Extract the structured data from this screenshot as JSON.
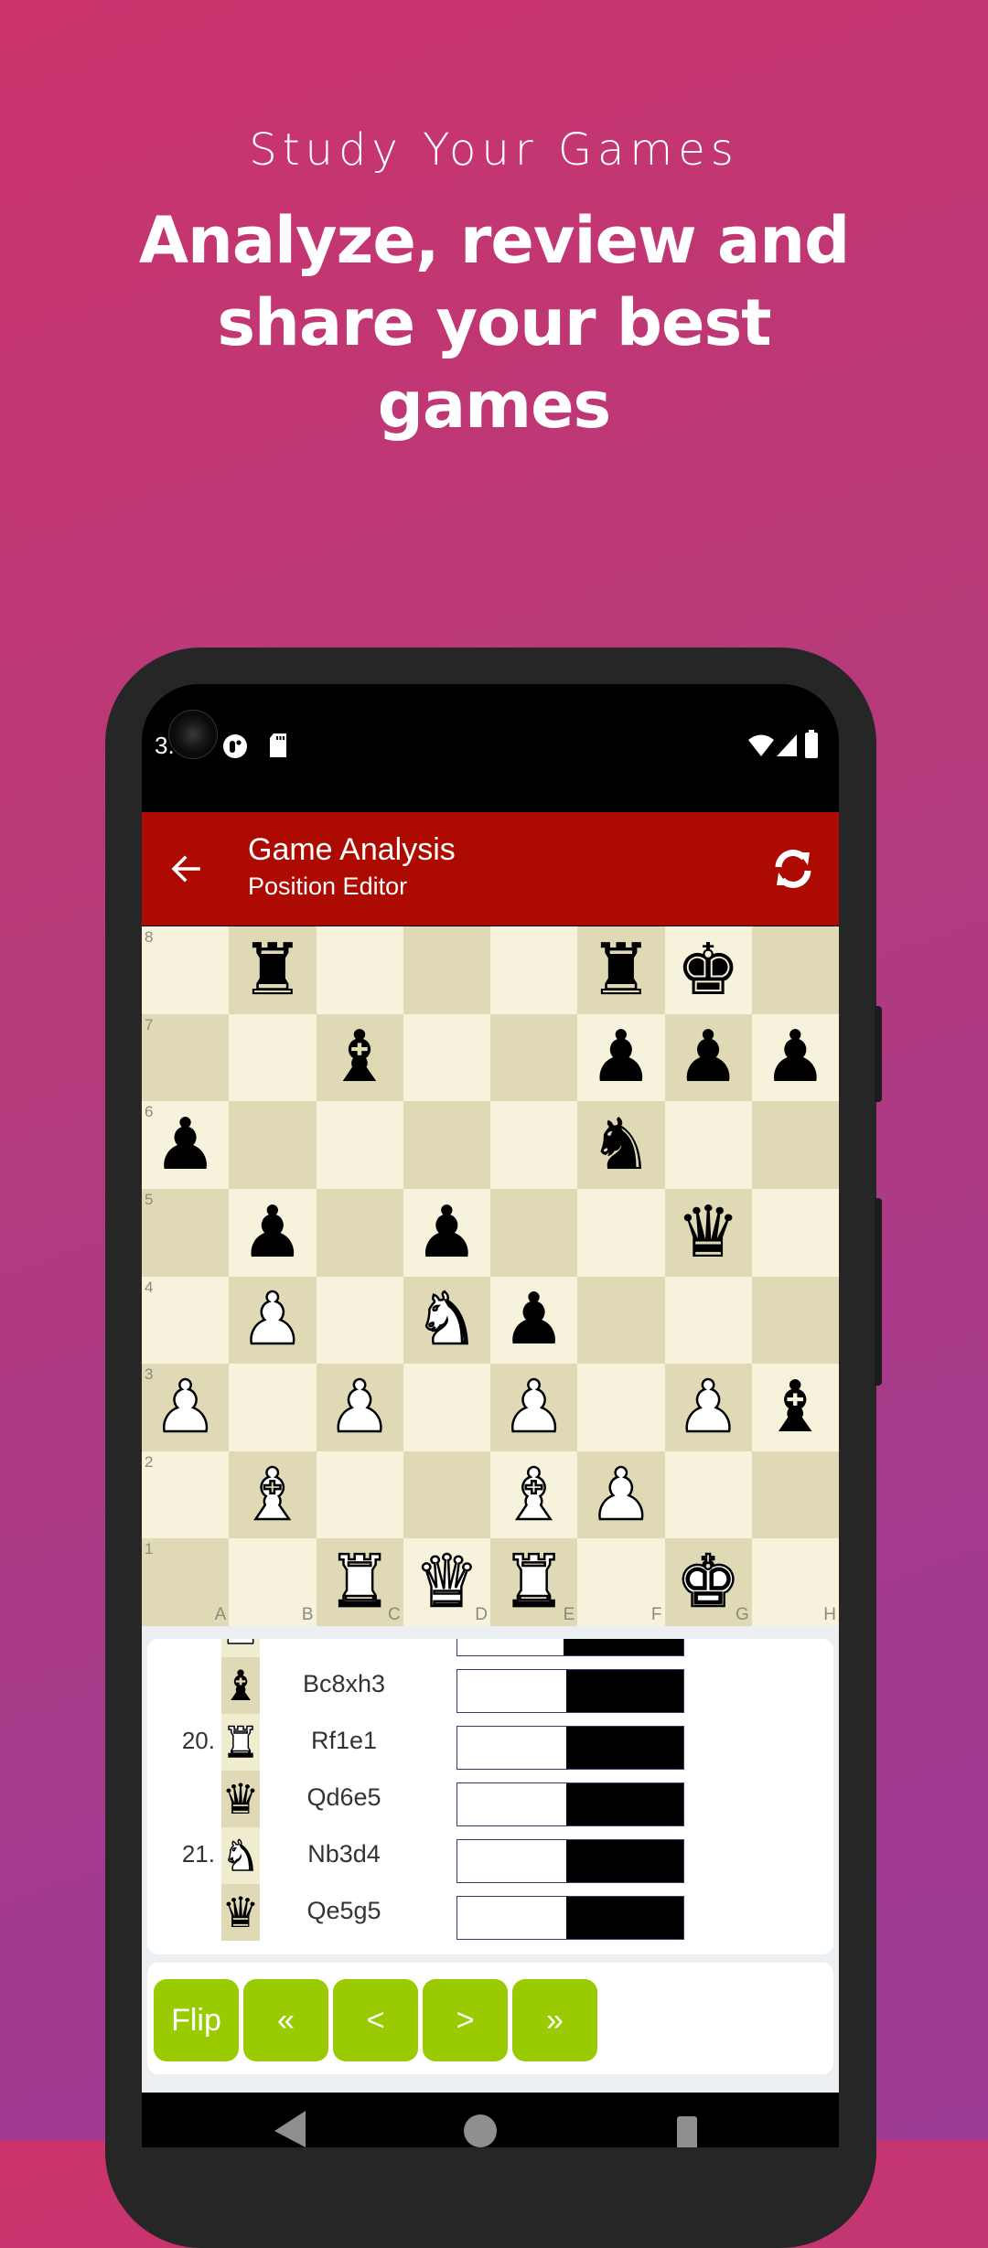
{
  "promo": {
    "subtitle": "Study Your Games",
    "title": "Analyze, review and share your best games"
  },
  "status_bar": {
    "time": "3.",
    "icons": [
      "app-notification-icon",
      "sd-card-icon",
      "wifi-icon",
      "signal-icon",
      "battery-icon"
    ]
  },
  "app_bar": {
    "title": "Game Analysis",
    "subtitle": "Position Editor",
    "back_icon": "arrow-left-icon",
    "action_icon": "refresh-icon",
    "color": "#ad0a02"
  },
  "board": {
    "ranks": [
      "8",
      "7",
      "6",
      "5",
      "4",
      "3",
      "2",
      "1"
    ],
    "files": [
      "A",
      "B",
      "C",
      "D",
      "E",
      "F",
      "G",
      "H"
    ],
    "rows": [
      [
        "",
        "bR",
        "",
        "",
        "",
        "bR",
        "bK",
        ""
      ],
      [
        "",
        "",
        "bB",
        "",
        "",
        "bP",
        "bP",
        "bP"
      ],
      [
        "bP",
        "",
        "",
        "",
        "",
        "bN",
        "",
        ""
      ],
      [
        "",
        "bP",
        "",
        "bP",
        "",
        "",
        "bQ",
        ""
      ],
      [
        "",
        "wP",
        "",
        "wN",
        "bP",
        "",
        "",
        ""
      ],
      [
        "wP",
        "",
        "wP",
        "",
        "wP",
        "",
        "wP",
        "bB"
      ],
      [
        "",
        "wB",
        "",
        "",
        "wB",
        "wP",
        "",
        ""
      ],
      [
        "",
        "",
        "wR",
        "wQ",
        "wR",
        "",
        "wK",
        ""
      ]
    ],
    "light_color": "#f7f2dc",
    "dark_color": "#dfdab5"
  },
  "moves": [
    {
      "number": "",
      "piece": "wP",
      "san": "",
      "eval_white_fraction": 0.47,
      "partial": true
    },
    {
      "number": "",
      "piece": "bB",
      "san": "Bc8xh3",
      "eval_white_fraction": 0.48
    },
    {
      "number": "20.",
      "piece": "wR",
      "san": "Rf1e1",
      "eval_white_fraction": 0.48
    },
    {
      "number": "",
      "piece": "bQ",
      "san": "Qd6e5",
      "eval_white_fraction": 0.48
    },
    {
      "number": "21.",
      "piece": "wN",
      "san": "Nb3d4",
      "eval_white_fraction": 0.48
    },
    {
      "number": "",
      "piece": "bQ",
      "san": "Qe5g5",
      "eval_white_fraction": 0.48
    }
  ],
  "controls": {
    "buttons": [
      {
        "id": "flip",
        "label": "Flip"
      },
      {
        "id": "first",
        "label": "«"
      },
      {
        "id": "prev",
        "label": "<"
      },
      {
        "id": "next",
        "label": ">"
      },
      {
        "id": "last",
        "label": "»"
      }
    ],
    "color": "#9acb00"
  },
  "nav_bar": {
    "icons": [
      "back-triangle-icon",
      "home-circle-icon",
      "recents-square-icon"
    ]
  }
}
